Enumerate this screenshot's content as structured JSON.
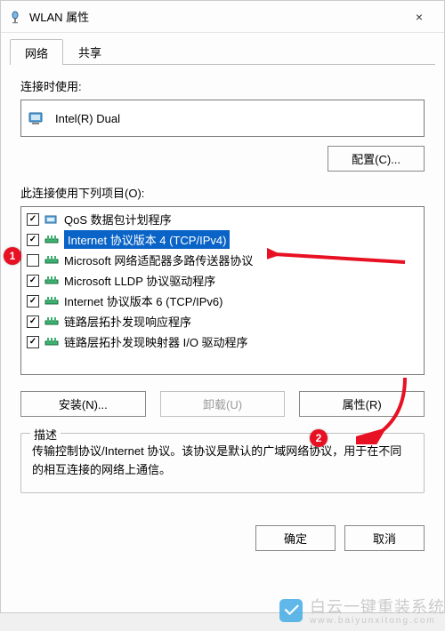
{
  "window": {
    "title": "WLAN 属性",
    "close_label": "×"
  },
  "tabs": [
    {
      "label": "网络",
      "active": true
    },
    {
      "label": "共享",
      "active": false
    }
  ],
  "connect_label": "连接时使用:",
  "adapter": {
    "name": "Intel(R) Dual"
  },
  "configure_btn": "配置(C)...",
  "items_label": "此连接使用下列项目(O):",
  "items": [
    {
      "checked": true,
      "icon": "qos",
      "label": "QoS 数据包计划程序",
      "selected": false
    },
    {
      "checked": true,
      "icon": "proto",
      "label": "Internet 协议版本 4 (TCP/IPv4)",
      "selected": true
    },
    {
      "checked": false,
      "icon": "proto",
      "label": "Microsoft 网络适配器多路传送器协议",
      "selected": false
    },
    {
      "checked": true,
      "icon": "proto",
      "label": "Microsoft LLDP 协议驱动程序",
      "selected": false
    },
    {
      "checked": true,
      "icon": "proto",
      "label": "Internet 协议版本 6 (TCP/IPv6)",
      "selected": false
    },
    {
      "checked": true,
      "icon": "proto",
      "label": "链路层拓扑发现响应程序",
      "selected": false
    },
    {
      "checked": true,
      "icon": "proto",
      "label": "链路层拓扑发现映射器 I/O 驱动程序",
      "selected": false
    }
  ],
  "buttons": {
    "install": "安装(N)...",
    "uninstall": "卸载(U)",
    "properties": "属性(R)"
  },
  "description": {
    "legend": "描述",
    "text": "传输控制协议/Internet 协议。该协议是默认的广域网络协议，用于在不同的相互连接的网络上通信。"
  },
  "dialog": {
    "ok": "确定",
    "cancel": "取消"
  },
  "markers": {
    "m1": "1",
    "m2": "2"
  },
  "watermark": {
    "brand": "白云一键重装系统",
    "url": "www.baiyunxitong.com"
  }
}
